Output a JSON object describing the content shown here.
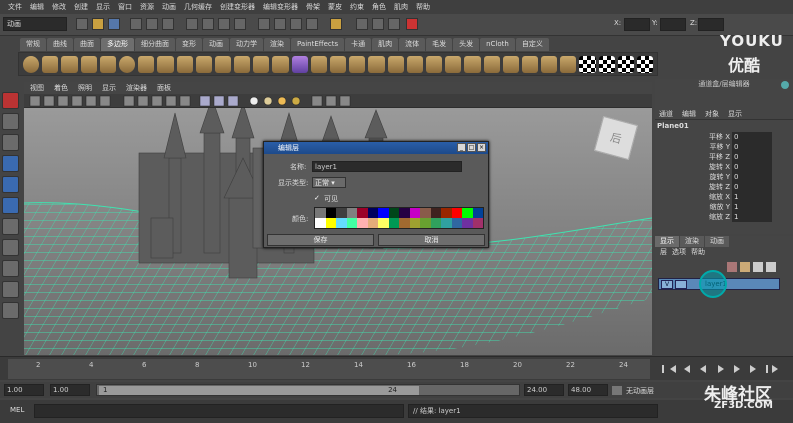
{
  "menubar": [
    "文件",
    "编辑",
    "修改",
    "创建",
    "显示",
    "窗口",
    "资源",
    "动画",
    "几何缓存",
    "创建变形器",
    "编辑变形器",
    "骨架",
    "蒙皮",
    "约束",
    "角色",
    "肌肉",
    "帮助"
  ],
  "status": {
    "mode": "动画",
    "x_label": "X:",
    "y_label": "Y:",
    "z_label": "Z:"
  },
  "shelf_tabs": [
    "常规",
    "曲线",
    "曲面",
    "多边形",
    "细分曲面",
    "变形",
    "动画",
    "动力学",
    "渲染",
    "PaintEffects",
    "卡通",
    "肌肉",
    "流体",
    "毛发",
    "头发",
    "nCloth",
    "自定义"
  ],
  "shelf_active": "多边形",
  "viewport_menu": [
    "视图",
    "着色",
    "照明",
    "显示",
    "渲染器",
    "面板"
  ],
  "viewcube_label": "后",
  "dialog": {
    "title": "编辑层",
    "name_label": "名称:",
    "name_value": "layer1",
    "display_type_label": "显示类型:",
    "display_type_value": "正常",
    "visible_check": "✓",
    "visible_label": "可见",
    "color_label": "颜色:",
    "save": "保存",
    "cancel": "取消",
    "min": "_",
    "max": "□",
    "close": "×"
  },
  "palette_colors": [
    "#777777",
    "#000000",
    "#3f3f3f",
    "#808080",
    "#9b0028",
    "#00005f",
    "#0000ff",
    "#004619",
    "#260043",
    "#c700c7",
    "#895c4a",
    "#3f231f",
    "#992600",
    "#ff0000",
    "#00ff00",
    "#004199",
    "#ffffff",
    "#ffff00",
    "#64dcff",
    "#43ffa3",
    "#ffb0b0",
    "#e4ac79",
    "#ffff63",
    "#009954",
    "#a16a30",
    "#9ea130",
    "#68a130",
    "#30a15d",
    "#30a1a1",
    "#3067a1",
    "#6f30a1",
    "#a1306a"
  ],
  "channel_box": {
    "header": "通道盒/层编辑器",
    "menu": [
      "通道",
      "编辑",
      "对象",
      "显示"
    ],
    "object": "Plane01",
    "attrs": [
      {
        "name": "平移 X",
        "value": "0"
      },
      {
        "name": "平移 Y",
        "value": "0"
      },
      {
        "name": "平移 Z",
        "value": "0"
      },
      {
        "name": "旋转 X",
        "value": "0"
      },
      {
        "name": "旋转 Y",
        "value": "0"
      },
      {
        "name": "旋转 Z",
        "value": "0"
      },
      {
        "name": "缩放 X",
        "value": "1"
      },
      {
        "name": "缩放 Y",
        "value": "1"
      },
      {
        "name": "缩放 Z",
        "value": "1"
      }
    ]
  },
  "layer_editor": {
    "tabs": [
      "显示",
      "渲染",
      "动画"
    ],
    "menu": [
      "层",
      "选项",
      "帮助"
    ],
    "layer_v": "V",
    "layer_name": "layer1"
  },
  "time_ticks": [
    "2",
    "4",
    "6",
    "8",
    "10",
    "12",
    "14",
    "16",
    "18",
    "20",
    "22",
    "24"
  ],
  "range": {
    "start": "1.00",
    "start2": "1.00",
    "range_start": "1",
    "range_end": "24",
    "end": "24.00",
    "end2": "48.00",
    "char_set": "无动画层"
  },
  "cmdline": {
    "label": "MEL",
    "result": "// 结果: layer1"
  },
  "watermarks": {
    "youku_en": "YOUKU",
    "youku_cn": "优酷",
    "site_cn": "朱峰社区",
    "site_en": "ZF3D.COM"
  }
}
